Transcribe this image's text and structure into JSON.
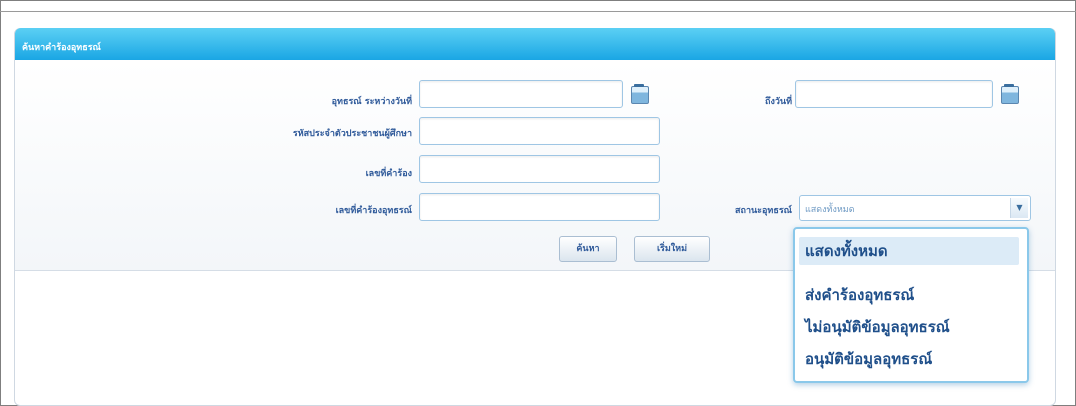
{
  "panel": {
    "title": "ค้นหาคำร้องอุทธรณ์"
  },
  "form": {
    "date_from_label": "อุทธรณ์ ระหว่างวันที่",
    "date_to_label": "ถึงวันที่",
    "student_id_label": "รหัสประจำตัวประชาชนผู้ศึกษา",
    "request_no_label": "เลขที่คำร้อง",
    "appeal_no_label": "เลขที่คำร้องอุทธรณ์",
    "status_label": "สถานะอุทธรณ์",
    "status_value": "แสดงทั้งหมด",
    "date_from_value": "",
    "date_to_value": "",
    "student_id_value": "",
    "request_no_value": "",
    "appeal_no_value": ""
  },
  "buttons": {
    "search": "ค้นหา",
    "reset": "เริ่มใหม่"
  },
  "status_options": [
    "แสดงทั้งหมด",
    "ส่งคำร้องอุทธรณ์",
    "ไม่อนุมัติข้อมูลอุทธรณ์",
    "อนุมัติข้อมูลอุทธรณ์"
  ],
  "icons": {
    "calendar": "calendar-icon",
    "dropdown": "chevron-down-icon"
  },
  "colors": {
    "header": "#1aa6e4",
    "text": "#2f5a9a",
    "highlight": "#dcebf7"
  }
}
